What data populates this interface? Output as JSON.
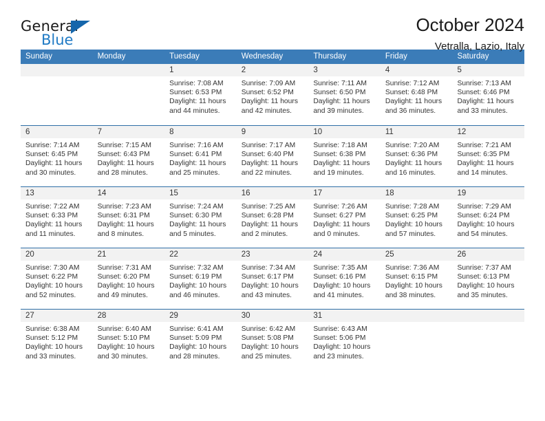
{
  "brand": {
    "name_top": "General",
    "name_bottom": "Blue",
    "triangle_color": "#1566ab",
    "blue_color": "#1f7ac4"
  },
  "header": {
    "title": "October 2024",
    "subtitle": "Vetralla, Lazio, Italy"
  },
  "colors": {
    "header_row_bg": "#3b7cb8",
    "row_divider": "#2e6ea6",
    "date_band_bg": "#f2f2f2",
    "text": "#333333"
  },
  "weekdays": [
    "Sunday",
    "Monday",
    "Tuesday",
    "Wednesday",
    "Thursday",
    "Friday",
    "Saturday"
  ],
  "labels": {
    "sunrise_prefix": "Sunrise: ",
    "sunset_prefix": "Sunset: ",
    "daylight_prefix": "Daylight: "
  },
  "weeks": [
    [
      {
        "day": "",
        "empty": true
      },
      {
        "day": "",
        "empty": true
      },
      {
        "day": "1",
        "sunrise": "Sunrise: 7:08 AM",
        "sunset": "Sunset: 6:53 PM",
        "daylight": "Daylight: 11 hours and 44 minutes."
      },
      {
        "day": "2",
        "sunrise": "Sunrise: 7:09 AM",
        "sunset": "Sunset: 6:52 PM",
        "daylight": "Daylight: 11 hours and 42 minutes."
      },
      {
        "day": "3",
        "sunrise": "Sunrise: 7:11 AM",
        "sunset": "Sunset: 6:50 PM",
        "daylight": "Daylight: 11 hours and 39 minutes."
      },
      {
        "day": "4",
        "sunrise": "Sunrise: 7:12 AM",
        "sunset": "Sunset: 6:48 PM",
        "daylight": "Daylight: 11 hours and 36 minutes."
      },
      {
        "day": "5",
        "sunrise": "Sunrise: 7:13 AM",
        "sunset": "Sunset: 6:46 PM",
        "daylight": "Daylight: 11 hours and 33 minutes."
      }
    ],
    [
      {
        "day": "6",
        "sunrise": "Sunrise: 7:14 AM",
        "sunset": "Sunset: 6:45 PM",
        "daylight": "Daylight: 11 hours and 30 minutes."
      },
      {
        "day": "7",
        "sunrise": "Sunrise: 7:15 AM",
        "sunset": "Sunset: 6:43 PM",
        "daylight": "Daylight: 11 hours and 28 minutes."
      },
      {
        "day": "8",
        "sunrise": "Sunrise: 7:16 AM",
        "sunset": "Sunset: 6:41 PM",
        "daylight": "Daylight: 11 hours and 25 minutes."
      },
      {
        "day": "9",
        "sunrise": "Sunrise: 7:17 AM",
        "sunset": "Sunset: 6:40 PM",
        "daylight": "Daylight: 11 hours and 22 minutes."
      },
      {
        "day": "10",
        "sunrise": "Sunrise: 7:18 AM",
        "sunset": "Sunset: 6:38 PM",
        "daylight": "Daylight: 11 hours and 19 minutes."
      },
      {
        "day": "11",
        "sunrise": "Sunrise: 7:20 AM",
        "sunset": "Sunset: 6:36 PM",
        "daylight": "Daylight: 11 hours and 16 minutes."
      },
      {
        "day": "12",
        "sunrise": "Sunrise: 7:21 AM",
        "sunset": "Sunset: 6:35 PM",
        "daylight": "Daylight: 11 hours and 14 minutes."
      }
    ],
    [
      {
        "day": "13",
        "sunrise": "Sunrise: 7:22 AM",
        "sunset": "Sunset: 6:33 PM",
        "daylight": "Daylight: 11 hours and 11 minutes."
      },
      {
        "day": "14",
        "sunrise": "Sunrise: 7:23 AM",
        "sunset": "Sunset: 6:31 PM",
        "daylight": "Daylight: 11 hours and 8 minutes."
      },
      {
        "day": "15",
        "sunrise": "Sunrise: 7:24 AM",
        "sunset": "Sunset: 6:30 PM",
        "daylight": "Daylight: 11 hours and 5 minutes."
      },
      {
        "day": "16",
        "sunrise": "Sunrise: 7:25 AM",
        "sunset": "Sunset: 6:28 PM",
        "daylight": "Daylight: 11 hours and 2 minutes."
      },
      {
        "day": "17",
        "sunrise": "Sunrise: 7:26 AM",
        "sunset": "Sunset: 6:27 PM",
        "daylight": "Daylight: 11 hours and 0 minutes."
      },
      {
        "day": "18",
        "sunrise": "Sunrise: 7:28 AM",
        "sunset": "Sunset: 6:25 PM",
        "daylight": "Daylight: 10 hours and 57 minutes."
      },
      {
        "day": "19",
        "sunrise": "Sunrise: 7:29 AM",
        "sunset": "Sunset: 6:24 PM",
        "daylight": "Daylight: 10 hours and 54 minutes."
      }
    ],
    [
      {
        "day": "20",
        "sunrise": "Sunrise: 7:30 AM",
        "sunset": "Sunset: 6:22 PM",
        "daylight": "Daylight: 10 hours and 52 minutes."
      },
      {
        "day": "21",
        "sunrise": "Sunrise: 7:31 AM",
        "sunset": "Sunset: 6:20 PM",
        "daylight": "Daylight: 10 hours and 49 minutes."
      },
      {
        "day": "22",
        "sunrise": "Sunrise: 7:32 AM",
        "sunset": "Sunset: 6:19 PM",
        "daylight": "Daylight: 10 hours and 46 minutes."
      },
      {
        "day": "23",
        "sunrise": "Sunrise: 7:34 AM",
        "sunset": "Sunset: 6:17 PM",
        "daylight": "Daylight: 10 hours and 43 minutes."
      },
      {
        "day": "24",
        "sunrise": "Sunrise: 7:35 AM",
        "sunset": "Sunset: 6:16 PM",
        "daylight": "Daylight: 10 hours and 41 minutes."
      },
      {
        "day": "25",
        "sunrise": "Sunrise: 7:36 AM",
        "sunset": "Sunset: 6:15 PM",
        "daylight": "Daylight: 10 hours and 38 minutes."
      },
      {
        "day": "26",
        "sunrise": "Sunrise: 7:37 AM",
        "sunset": "Sunset: 6:13 PM",
        "daylight": "Daylight: 10 hours and 35 minutes."
      }
    ],
    [
      {
        "day": "27",
        "sunrise": "Sunrise: 6:38 AM",
        "sunset": "Sunset: 5:12 PM",
        "daylight": "Daylight: 10 hours and 33 minutes."
      },
      {
        "day": "28",
        "sunrise": "Sunrise: 6:40 AM",
        "sunset": "Sunset: 5:10 PM",
        "daylight": "Daylight: 10 hours and 30 minutes."
      },
      {
        "day": "29",
        "sunrise": "Sunrise: 6:41 AM",
        "sunset": "Sunset: 5:09 PM",
        "daylight": "Daylight: 10 hours and 28 minutes."
      },
      {
        "day": "30",
        "sunrise": "Sunrise: 6:42 AM",
        "sunset": "Sunset: 5:08 PM",
        "daylight": "Daylight: 10 hours and 25 minutes."
      },
      {
        "day": "31",
        "sunrise": "Sunrise: 6:43 AM",
        "sunset": "Sunset: 5:06 PM",
        "daylight": "Daylight: 10 hours and 23 minutes."
      },
      {
        "day": "",
        "empty": true
      },
      {
        "day": "",
        "empty": true
      }
    ]
  ]
}
